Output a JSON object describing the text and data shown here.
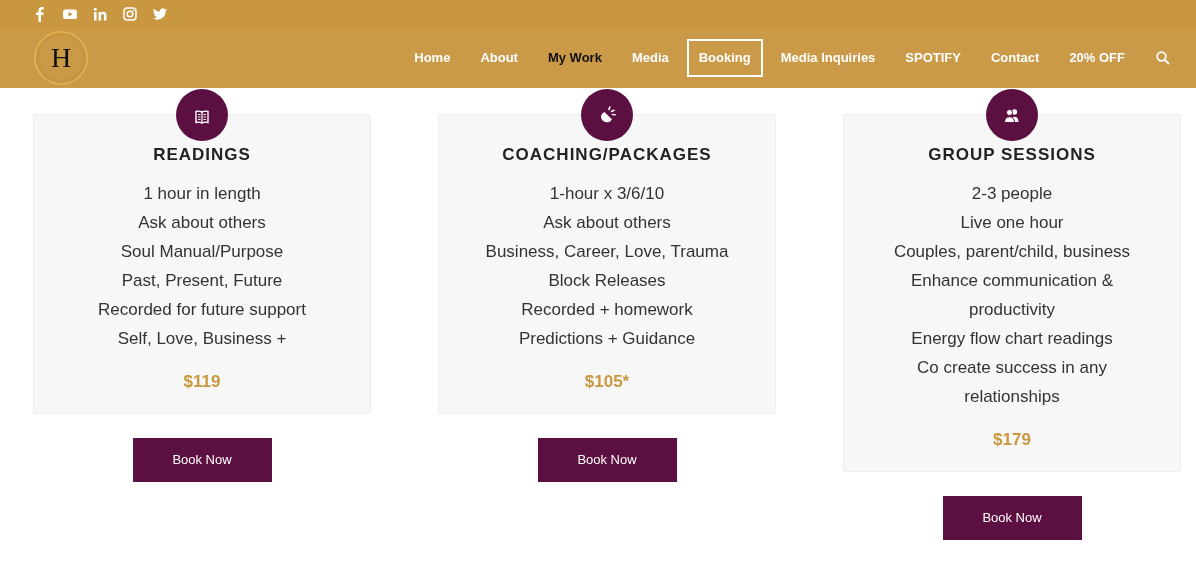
{
  "social": [
    {
      "kind": "facebook"
    },
    {
      "kind": "youtube"
    },
    {
      "kind": "linkedin"
    },
    {
      "kind": "instagram"
    },
    {
      "kind": "twitter"
    }
  ],
  "logo": {
    "letter": "H"
  },
  "nav": [
    {
      "label": "Home",
      "selected": false,
      "kind": "link"
    },
    {
      "label": "About",
      "selected": false,
      "kind": "link"
    },
    {
      "label": "My Work",
      "selected": true,
      "kind": "link"
    },
    {
      "label": "Media",
      "selected": false,
      "kind": "link"
    },
    {
      "label": "Booking",
      "selected": false,
      "kind": "boxed"
    },
    {
      "label": "Media Inquiries",
      "selected": false,
      "kind": "link"
    },
    {
      "label": "SPOTIFY",
      "selected": false,
      "kind": "link"
    },
    {
      "label": "Contact",
      "selected": false,
      "kind": "link"
    },
    {
      "label": "20% OFF",
      "selected": false,
      "kind": "link"
    }
  ],
  "offers": [
    {
      "kind": "book",
      "title": "READINGS",
      "lines": [
        "1 hour in length",
        "Ask about others",
        "Soul Manual/Purpose",
        "Past, Present, Future",
        "Recorded for future support",
        "Self, Love, Business +"
      ],
      "price": "$119",
      "button": "Book Now"
    },
    {
      "kind": "bulb",
      "title": "COACHING/PACKAGES",
      "lines": [
        "1-hour x 3/6/10",
        "Ask about others",
        "Business, Career, Love, Trauma",
        "Block Releases",
        "Recorded + homework",
        "Predictions + Guidance"
      ],
      "price": "$105*",
      "button": "Book Now"
    },
    {
      "kind": "people",
      "title": "GROUP SESSIONS",
      "lines": [
        "2-3 people",
        "Live one hour",
        "Couples, parent/child, business",
        "Enhance communication & productivity",
        "Energy flow chart readings",
        "Co create success in any relationships"
      ],
      "price": "$179",
      "button": "Book Now"
    }
  ]
}
